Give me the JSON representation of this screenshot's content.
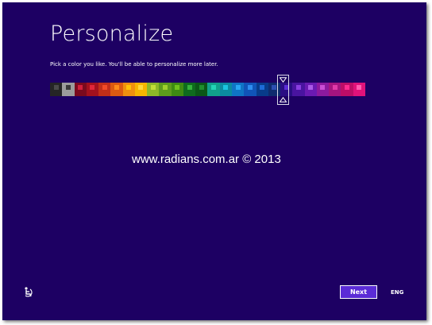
{
  "page": {
    "title": "Personalize",
    "subtitle": "Pick a color you like. You'll be able to personalize more later.",
    "watermark": "www.radians.com.ar © 2013"
  },
  "palette": {
    "swatches": [
      {
        "bg": "#252525",
        "mark": "#4a4a4a"
      },
      {
        "bg": "#9c9c9c",
        "mark": "#3a3a3a"
      },
      {
        "bg": "#7a0a1e",
        "mark": "#d01f3c"
      },
      {
        "bg": "#a3111e",
        "mark": "#e0263a"
      },
      {
        "bg": "#c12e19",
        "mark": "#f04a28"
      },
      {
        "bg": "#dc5a10",
        "mark": "#ff8c1a"
      },
      {
        "bg": "#f0900e",
        "mark": "#ffc107"
      },
      {
        "bg": "#f7b500",
        "mark": "#ffd83a"
      },
      {
        "bg": "#8db928",
        "mark": "#c1df38"
      },
      {
        "bg": "#5d9d1c",
        "mark": "#9fd12d"
      },
      {
        "bg": "#3e8b12",
        "mark": "#6fc21c"
      },
      {
        "bg": "#0f6b1e",
        "mark": "#34b23b"
      },
      {
        "bg": "#0b5617",
        "mark": "#1e8e2d"
      },
      {
        "bg": "#11a08b",
        "mark": "#23d3b6"
      },
      {
        "bg": "#0b8ba0",
        "mark": "#1bc4e0"
      },
      {
        "bg": "#0f74c5",
        "mark": "#28a7f5"
      },
      {
        "bg": "#1054b8",
        "mark": "#2e8df0"
      },
      {
        "bg": "#083b8a",
        "mark": "#1d6bd8"
      },
      {
        "bg": "#0e2c6e",
        "mark": "#2c4fb2"
      },
      {
        "bg": "#2a0e83",
        "mark": "#5b2cd6"
      },
      {
        "bg": "#4914a0",
        "mark": "#8a3ee0"
      },
      {
        "bg": "#6a1ab2",
        "mark": "#aa5ae8"
      },
      {
        "bg": "#8c1a9e",
        "mark": "#c94fd6"
      },
      {
        "bg": "#a5147f",
        "mark": "#e03aa9"
      },
      {
        "bg": "#bc0d67",
        "mark": "#ff2b91"
      },
      {
        "bg": "#e0127a",
        "mark": "#ff5cb0"
      }
    ],
    "selected_index": 19
  },
  "footer": {
    "next_label": "Next",
    "language": "ENG"
  },
  "icons": {
    "ease_of_access": "ease-of-access-icon",
    "selector_up": "triangle-down-icon",
    "selector_down": "triangle-up-icon"
  },
  "colors": {
    "background": "#1d0063",
    "accent_button": "#5b2cd6",
    "text": "#ffffff"
  }
}
